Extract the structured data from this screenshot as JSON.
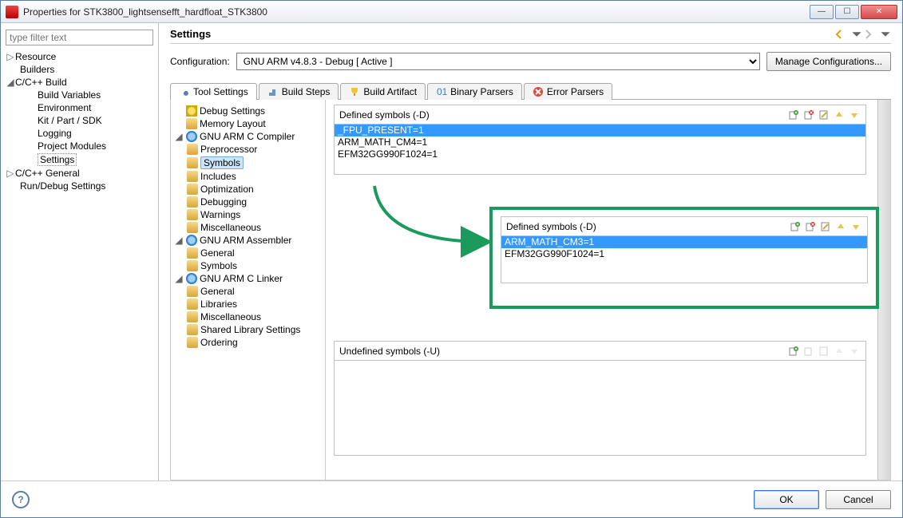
{
  "window": {
    "title": "Properties for STK3800_lightsensefft_hardfloat_STK3800"
  },
  "filter": {
    "placeholder": "type filter text"
  },
  "nav": {
    "resource": "Resource",
    "builders": "Builders",
    "ccbuild": "C/C++ Build",
    "buildvars": "Build Variables",
    "environment": "Environment",
    "kitpartsdk": "Kit / Part / SDK",
    "logging": "Logging",
    "projectmodules": "Project Modules",
    "settings": "Settings",
    "ccgeneral": "C/C++ General",
    "rundebug": "Run/Debug Settings"
  },
  "header": {
    "title": "Settings"
  },
  "config": {
    "label": "Configuration:",
    "selected": "GNU ARM v4.8.3 - Debug  [ Active ]",
    "manage": "Manage Configurations..."
  },
  "tabs": {
    "toolsettings": "Tool Settings",
    "buildsteps": "Build Steps",
    "buildartifact": "Build Artifact",
    "binaryparsers": "Binary Parsers",
    "errorparsers": "Error Parsers"
  },
  "tooltree": {
    "debugsettings": "Debug Settings",
    "memorylayout": "Memory Layout",
    "ccompiler": "GNU ARM C Compiler",
    "preprocessor": "Preprocessor",
    "symbols": "Symbols",
    "includes": "Includes",
    "optimization": "Optimization",
    "debugging": "Debugging",
    "warnings": "Warnings",
    "misc": "Miscellaneous",
    "assembler": "GNU ARM Assembler",
    "asm_general": "General",
    "asm_symbols": "Symbols",
    "linker": "GNU ARM C Linker",
    "lnk_general": "General",
    "lnk_libraries": "Libraries",
    "lnk_misc": "Miscellaneous",
    "lnk_shared": "Shared Library Settings",
    "lnk_ordering": "Ordering"
  },
  "panels": {
    "defined_label": "Defined symbols (-D)",
    "undefined_label": "Undefined symbols (-U)",
    "before": {
      "items": [
        "_FPU_PRESENT=1",
        "ARM_MATH_CM4=1",
        "EFM32GG990F1024=1"
      ],
      "selected_index": 0
    },
    "after": {
      "items": [
        "ARM_MATH_CM3=1",
        "EFM32GG990F1024=1"
      ],
      "selected_index": 0
    }
  },
  "footer": {
    "ok": "OK",
    "cancel": "Cancel"
  }
}
